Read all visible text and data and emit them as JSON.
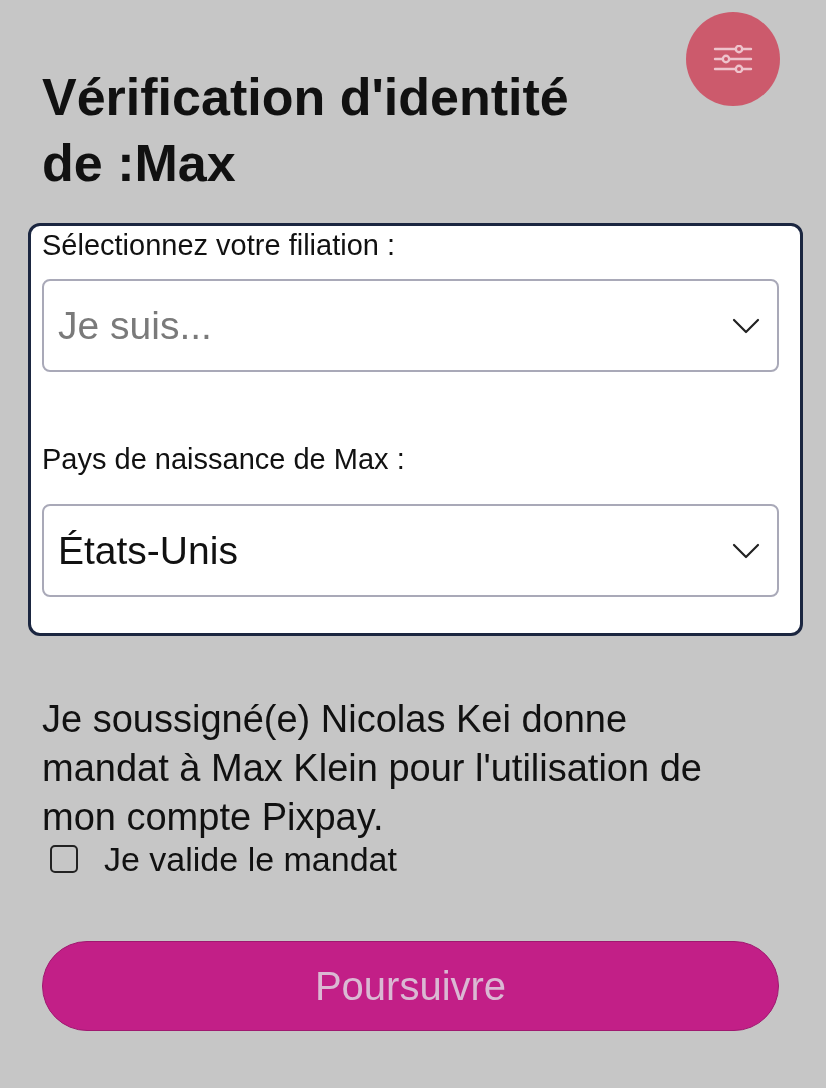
{
  "title": "Vérification d'identité de :Max",
  "form": {
    "fields": [
      {
        "label": "Sélectionnez votre filiation :",
        "placeholder": "Je suis..."
      },
      {
        "label": "Pays de naissance de Max :",
        "value": "États-Unis"
      }
    ]
  },
  "mandate": {
    "text": "Je soussigné(e) Nicolas Kei donne mandat à Max Klein pour l'utilisation de mon compte Pixpay.",
    "checkbox": {
      "label": "Je valide le mandat",
      "checked": false
    }
  },
  "button": {
    "label": "Poursuivre"
  }
}
